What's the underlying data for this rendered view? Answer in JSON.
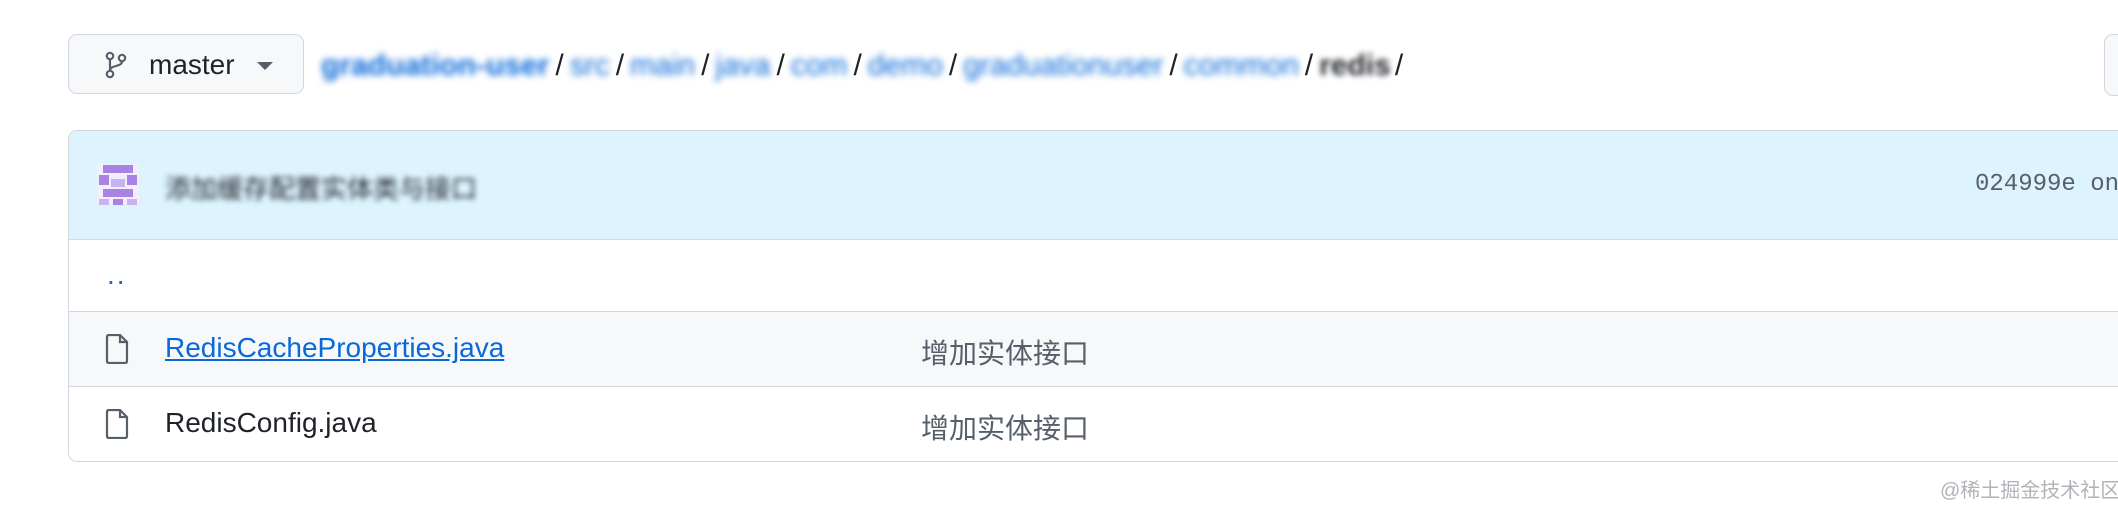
{
  "branch": {
    "name": "master",
    "icon": "git-branch-icon"
  },
  "breadcrumb": {
    "segments": [
      "graduation-user",
      "src",
      "main",
      "java",
      "com",
      "demo",
      "graduationuser",
      "common"
    ],
    "current": "redis",
    "separator": "/"
  },
  "commit": {
    "avatar": "identicon-avatar",
    "message": "添加缓存配置实体类与接口",
    "hash": "024999e on"
  },
  "files": {
    "parent_link": "..",
    "items": [
      {
        "name": "RedisCacheProperties.java",
        "message": "增加实体接口",
        "icon": "file-icon"
      },
      {
        "name": "RedisConfig.java",
        "message": "增加实体接口",
        "icon": "file-icon"
      }
    ]
  },
  "watermark": "@稀土掘金技术社区",
  "colors": {
    "link": "#0969da",
    "commit_bar": "#ddf4ff",
    "border": "#d0d7de"
  }
}
